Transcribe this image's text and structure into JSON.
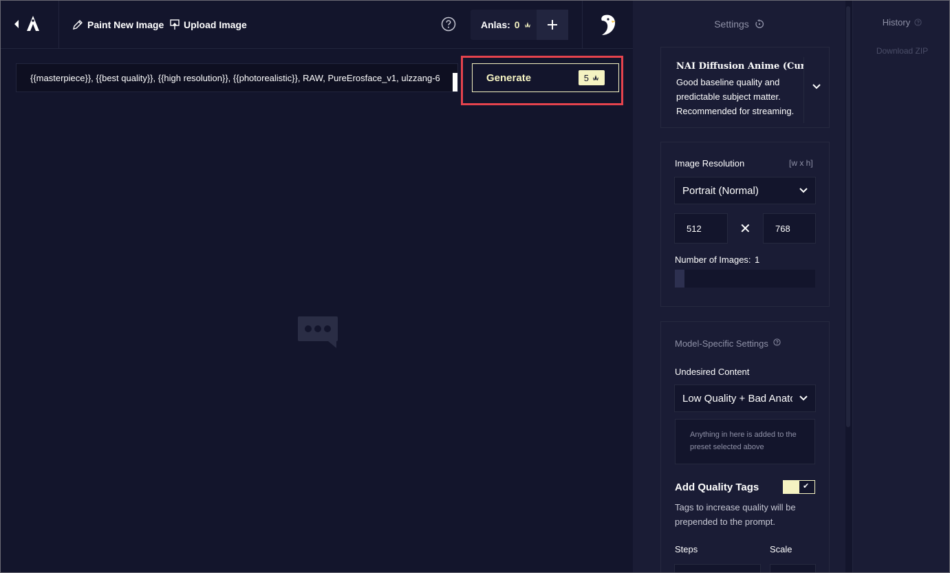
{
  "header": {
    "paint_new_image": "Paint New Image",
    "upload_image": "Upload Image",
    "anlas_label": "Anlas:",
    "anlas_value": "0"
  },
  "prompt": {
    "value": "{{masterpiece}}, {{best quality}}, {{high resolution}}, {{photorealistic}}, RAW, PureErosface_v1, ulzzang-6"
  },
  "generate": {
    "label": "Generate",
    "cost": "5"
  },
  "settings": {
    "title": "Settings",
    "model": {
      "name": "NAI Diffusion Anime (Curated)",
      "description": "Good baseline quality and predictable subject matter. Recommended for streaming."
    },
    "resolution": {
      "label": "Image Resolution",
      "hint": "[w x h]",
      "preset": "Portrait (Normal)",
      "width": "512",
      "height": "768",
      "times_symbol": "✕"
    },
    "num_images": {
      "label": "Number of Images:",
      "value": "1",
      "fraction": 0.07
    },
    "model_specific": {
      "title": "Model-Specific Settings",
      "undesired_label": "Undesired Content",
      "undesired_preset": "Low Quality + Bad Anatomy",
      "undesired_placeholder": "Anything in here is added to the preset selected above",
      "quality_tags_label": "Add Quality Tags",
      "quality_tags_enabled": true,
      "quality_tags_desc": "Tags to increase quality will be prepended to the prompt.",
      "steps_label": "Steps",
      "scale_label": "Scale"
    }
  },
  "history": {
    "title": "History",
    "download": "Download ZIP"
  },
  "colors": {
    "accent": "#f5f3c2",
    "background": "#13152c",
    "panel": "#1a1c35",
    "highlight": "#e5434d"
  }
}
